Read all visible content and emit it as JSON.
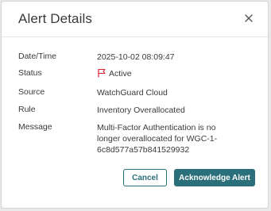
{
  "dialog": {
    "title": "Alert Details"
  },
  "fields": {
    "date_label": "Date/Time",
    "date_value": "2025-10-02 08:09:47",
    "status_label": "Status",
    "status_value": "Active",
    "source_label": "Source",
    "source_value": "WatchGuard Cloud",
    "rule_label": "Rule",
    "rule_value": "Inventory Overallocated",
    "message_label": "Message",
    "message_value": "Multi-Factor Authentication is no longer overallocated for WGC-1-6c8d577a57b841529932"
  },
  "buttons": {
    "cancel": "Cancel",
    "acknowledge": "Acknowledge Alert"
  },
  "icons": {
    "close": "close-icon",
    "status": "flag-icon"
  },
  "colors": {
    "accent": "#2b6f7a",
    "status_flag": "#d9263a"
  }
}
